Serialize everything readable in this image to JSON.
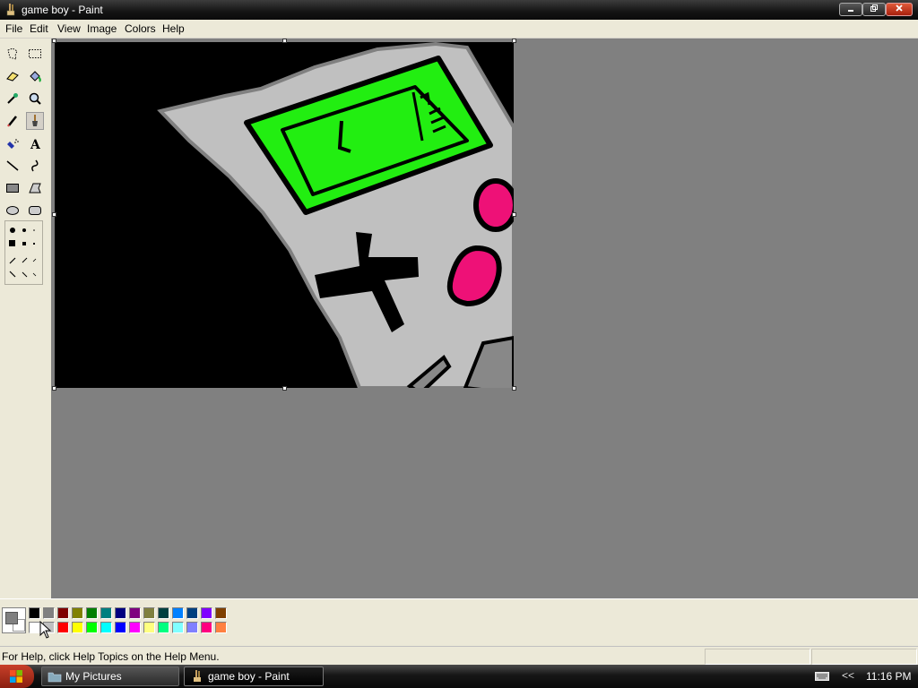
{
  "window": {
    "title": "game boy - Paint",
    "controls": {
      "minimize": "minimize",
      "maximize": "restore",
      "close": "close"
    }
  },
  "menu": [
    "File",
    "Edit",
    "View",
    "Image",
    "Colors",
    "Help"
  ],
  "tools": [
    "free-form-select",
    "select",
    "eraser",
    "fill-with-color",
    "pick-color",
    "magnifier",
    "pencil",
    "brush",
    "airbrush",
    "text",
    "line",
    "curve",
    "rectangle",
    "polygon",
    "ellipse",
    "rounded-rectangle"
  ],
  "selected_tool": "brush",
  "palette": {
    "foreground": "#808080",
    "background": "#ffffff",
    "row1": [
      "#000000",
      "#808080",
      "#800000",
      "#808000",
      "#008000",
      "#008080",
      "#000080",
      "#800080",
      "#808040",
      "#004040",
      "#0080ff",
      "#004080",
      "#8000ff",
      "#804000"
    ],
    "row2": [
      "#ffffff",
      "#c0c0c0",
      "#ff0000",
      "#ffff00",
      "#00ff00",
      "#00ffff",
      "#0000ff",
      "#ff00ff",
      "#ffff80",
      "#00ff80",
      "#80ffff",
      "#8080ff",
      "#ff0080",
      "#ff8040"
    ]
  },
  "status": {
    "text": "For Help, click Help Topics on the Help Menu."
  },
  "taskbar": {
    "buttons": [
      {
        "label": "My Pictures",
        "icon": "folder-icon"
      },
      {
        "label": "game boy - Paint",
        "icon": "paint-icon",
        "active": true
      }
    ],
    "clock": "11:16 PM",
    "tray_arrows": "<<"
  }
}
